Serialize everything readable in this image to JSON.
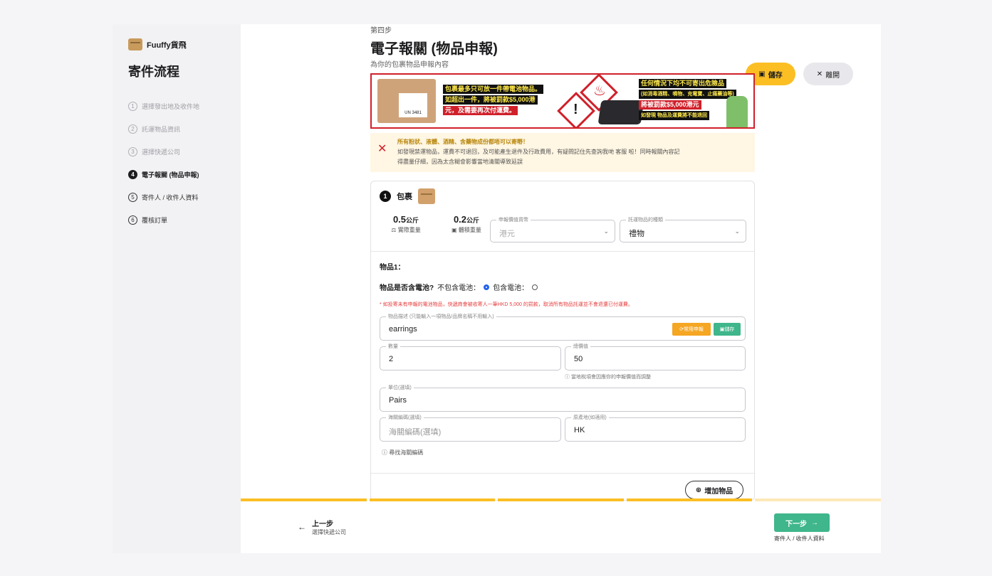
{
  "app": {
    "logo_text": "Fuuffy貨飛"
  },
  "sidebar": {
    "title": "寄件流程",
    "steps": [
      {
        "num": "1",
        "label": "選擇發出地及收件地"
      },
      {
        "num": "2",
        "label": "託運物品資訊"
      },
      {
        "num": "3",
        "label": "選擇快遞公司"
      },
      {
        "num": "4",
        "label": "電子報關 (物品申報)"
      },
      {
        "num": "5",
        "label": "寄件人 / 收件人資料"
      },
      {
        "num": "6",
        "label": "覆核訂單"
      }
    ]
  },
  "header": {
    "step_label": "第四步",
    "title": "電子報關 (物品申報)",
    "subtitle": "為你的包裹物品申報內容",
    "save_label": "儲存",
    "leave_label": "離開"
  },
  "banner": {
    "box_label": "UN 3481",
    "line1a": "包裹最多只可放一件帶電池物品。",
    "line1b": "如超出一件，將被罰款$5,000港",
    "line1c": "元，及需要再次付運費。",
    "line2a": "任何情況下均不可寄出危險品",
    "line2b": "(如消毒酒精、噴物、充電寶、止痛藥油等)",
    "line2c": "將被罰款$5,000港元",
    "line2d": "如發現 物品及運費將不能退回"
  },
  "warning": {
    "line1": "所有粉狀、液體、酒精、含藥物成份都唔可以寄嘢！",
    "line2": "如發現禁運物品，運費不可退回，及可能產生退件及行政費用，有疑問記住先查詢我哋 客服 啦！同時報關內容記",
    "line3": "得盡量仔細，因為太含糊會影響當地清關導致延誤"
  },
  "package": {
    "num": "1",
    "title": "包裹",
    "actual_weight_value": "0.5",
    "actual_weight_unit": "公斤",
    "actual_weight_label": "實際重量",
    "vol_weight_value": "0.2",
    "vol_weight_unit": "公斤",
    "vol_weight_label": "體積重量",
    "currency_label": "申報價值貨幣",
    "currency_value": "港元",
    "type_label": "託運物品的種類",
    "type_value": "禮物"
  },
  "item": {
    "heading": "物品1：",
    "battery_question": "物品是否含電池?",
    "battery_no": "不包含電池：",
    "battery_yes": "包含電池：",
    "battery_note": "* 如投寄未有申報的電池物品，快遞商會被收寄人一筆HKD 5,000 的罰款，取消所有物品託運並不會退還已付運費。",
    "desc_label": "物品描述 (只能輸入一項物品/品牌名稱不用輸入)",
    "desc_value": "earrings",
    "common_btn": "常用申報",
    "save_btn": "儲存",
    "qty_label": "數量",
    "qty_value": "2",
    "value_label": "總價值",
    "value_value": "50",
    "value_hint": "當地稅項會因應你的申報價值而調整",
    "unit_label": "單位(選填)",
    "unit_value": "Pairs",
    "hs_label": "海關編碼(選填)",
    "hs_placeholder": "海關編碼(選填)",
    "origin_label": "原產地(如適用)",
    "origin_value": "HK",
    "hs_hint": "尋找海關編碼",
    "add_item": "增加物品"
  },
  "footer": {
    "prev_title": "上一步",
    "prev_sub": "選擇快遞公司",
    "next_title": "下一步",
    "next_sub": "寄件人 / 收件人資料"
  },
  "colors": {
    "accent": "#fbbf24",
    "next": "#3fb68b",
    "danger": "#d0202a"
  }
}
